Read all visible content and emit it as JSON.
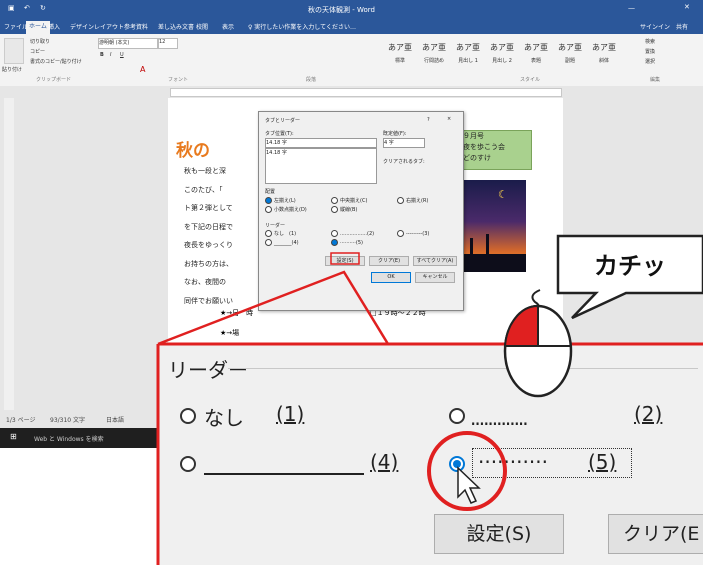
{
  "word": {
    "window_title": "秋の天体観測 - Word",
    "tell_me": "♀ 実行したい作業を入力してください…",
    "account": "サインイン",
    "share": "共有",
    "tabs": [
      "ファイル",
      "ホーム",
      "挿入",
      "デザイン",
      "レイアウト",
      "参考資料",
      "差し込み文書",
      "校閲",
      "表示"
    ],
    "ribbon": {
      "clipboard": {
        "paste": "貼り付け",
        "cut": "切り取り",
        "copy": "コピー",
        "format_painter": "書式のコピー/貼り付け",
        "group": "クリップボード"
      },
      "font": {
        "name": "游明朝 (本文)",
        "size": "12",
        "group": "フォント"
      },
      "paragraph_group": "段落",
      "styles": [
        {
          "sample": "あア亜",
          "name": "標準"
        },
        {
          "sample": "あア亜",
          "name": "行間詰め"
        },
        {
          "sample": "あア亜",
          "name": "見出し 1"
        },
        {
          "sample": "あア亜",
          "name": "見出し 2"
        },
        {
          "sample": "あア亜",
          "name": "表題"
        },
        {
          "sample": "あア亜",
          "name": "副題"
        },
        {
          "sample": "あア亜",
          "name": "斜体"
        }
      ],
      "styles_group": "スタイル",
      "editing": {
        "find": "検索",
        "replace": "置換",
        "select": "選択",
        "group": "編集"
      }
    },
    "doc": {
      "title_fragment": "秋の",
      "lines": [
        "秋も一段と深",
        "このたび、「",
        "ト第２弾として",
        "を下記の日程で",
        "夜長をゆっくり",
        "お持ちの方は、",
        "なお、夜間の",
        "同伴でお願いい"
      ],
      "callout_lines": [
        "９月号",
        "夜を歩こう会",
        "どのすけ"
      ],
      "item1": "★→日　時",
      "item1_value": "□１９時～２２時",
      "item2": "★→場"
    },
    "status": {
      "page": "1/3 ページ",
      "words": "93/310 文字",
      "lang": "日本語"
    },
    "taskbar_search": "Web と Windows を検索"
  },
  "dialog": {
    "title": "タブとリーダー",
    "help": "?",
    "close": "×",
    "tab_position_label": "タブ位置(T):",
    "tab_position_value": "14.18 字",
    "tab_list": [
      "14.18 字"
    ],
    "default_tabs_label": "既定値(F):",
    "default_tabs_value": "4 字",
    "clear_label": "クリアされるタブ:",
    "alignment_label": "配置",
    "alignment": [
      "左揃え(L)",
      "中央揃え(C)",
      "右揃え(R)",
      "小数点揃え(D)",
      "縦線(B)"
    ],
    "leader_label": "リーダー",
    "leader_options": [
      "なし　(1)",
      ".................(2)",
      "---------(3)",
      "_______(4)",
      "··········(5)"
    ],
    "set": "設定(S)",
    "clear": "クリア(E)",
    "clear_all": "すべてクリア(A)",
    "ok": "OK",
    "cancel": "キャンセル"
  },
  "zoom": {
    "leader_label": "リーダー",
    "none_option": "なし",
    "none_num": "(1)",
    "dots_num": "(2)",
    "underline_num": "(4)",
    "middot_num": "(5)",
    "set_button": "設定(S)",
    "clear_button": "クリア(E"
  },
  "callout": {
    "text": "カチッ"
  },
  "colors": {
    "word_blue": "#2b579a",
    "highlight_red": "#e02020",
    "radio_blue": "#0078d7"
  }
}
